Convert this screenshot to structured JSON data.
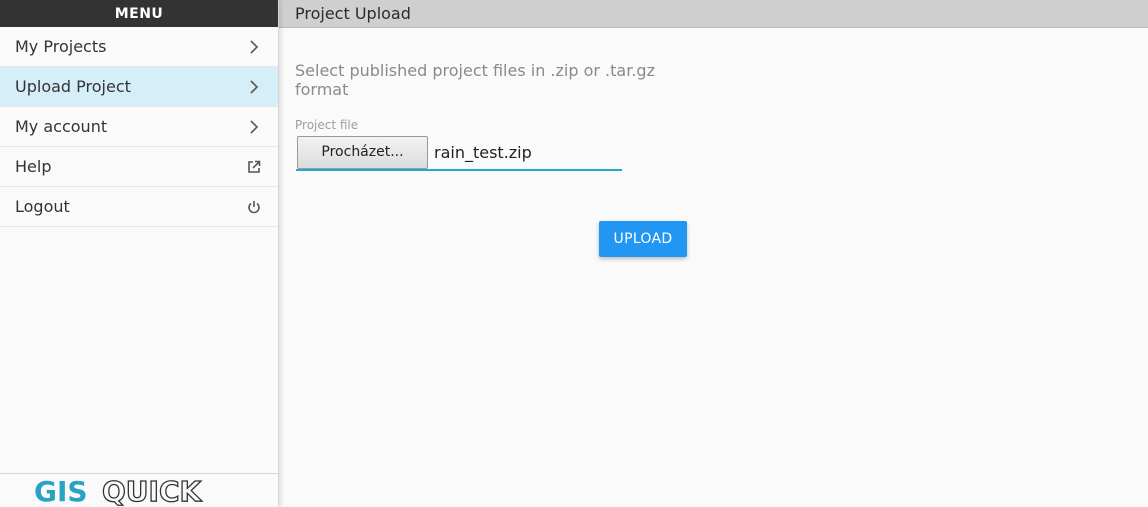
{
  "sidebar": {
    "header": "MENU",
    "items": [
      {
        "label": "My Projects",
        "icon": "chevron-right-icon"
      },
      {
        "label": "Upload Project",
        "icon": "chevron-right-icon",
        "active": true
      },
      {
        "label": "My account",
        "icon": "chevron-right-icon"
      },
      {
        "label": "Help",
        "icon": "external-link-icon"
      },
      {
        "label": "Logout",
        "icon": "power-icon"
      }
    ],
    "logo": {
      "part1": "GIS",
      "part2": "QUICK",
      "color1": "#29a3c4",
      "color2": "#333333"
    }
  },
  "page": {
    "title": "Project Upload",
    "description": "Select published project files in .zip or .tar.gz format",
    "field_label": "Project file",
    "browse_label": "Procházet...",
    "file_name": "rain_test.zip",
    "upload_label": "UPLOAD"
  },
  "colors": {
    "accent": "#2196f3",
    "active_item_bg": "#d6eef7",
    "input_underline": "#25a8c9",
    "menu_header_bg": "#333333"
  }
}
